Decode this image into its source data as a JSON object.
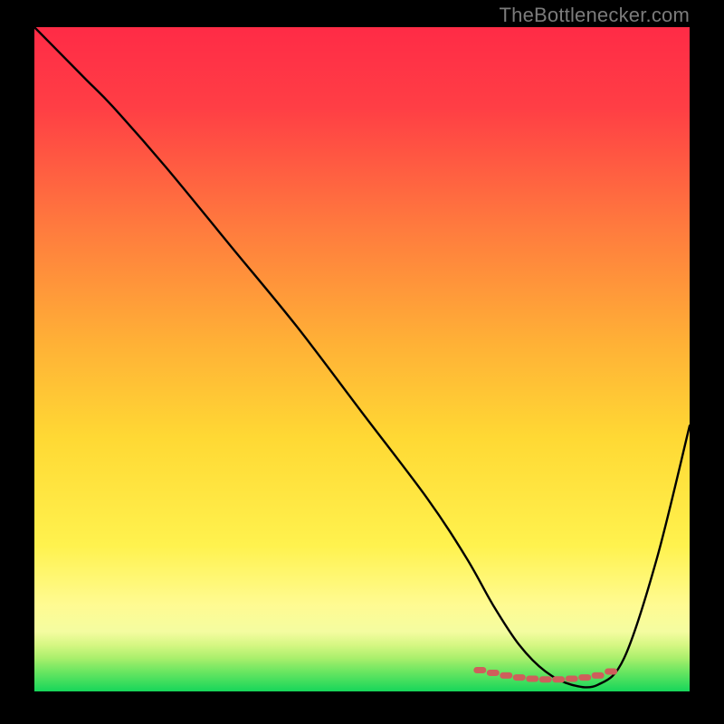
{
  "watermark": "TheBottlenecker.com",
  "chart_data": {
    "type": "line",
    "title": "",
    "xlabel": "",
    "ylabel": "",
    "xlim": [
      0,
      100
    ],
    "ylim": [
      0,
      100
    ],
    "background_gradient": {
      "top": "#ff2b46",
      "mid_upper": "#ff8a3a",
      "mid": "#ffd934",
      "mid_lower": "#fff77a",
      "green_top": "#b6f56a",
      "green_bottom": "#16d65a"
    },
    "series": [
      {
        "name": "curve",
        "color": "#000000",
        "x": [
          0,
          5,
          8,
          12,
          20,
          30,
          40,
          50,
          60,
          66,
          70,
          74,
          78,
          82,
          86,
          90,
          95,
          100
        ],
        "y": [
          100,
          95,
          92,
          88,
          79,
          67,
          55,
          42,
          29,
          20,
          13,
          7,
          3,
          1,
          1,
          5,
          20,
          40
        ]
      },
      {
        "name": "valley-highlight",
        "color": "#ce5f5b",
        "type": "scatter",
        "x": [
          68,
          70,
          72,
          74,
          76,
          78,
          80,
          82,
          84,
          86,
          88
        ],
        "y": [
          3.2,
          2.8,
          2.4,
          2.1,
          1.9,
          1.8,
          1.8,
          1.9,
          2.1,
          2.4,
          3.0
        ]
      }
    ]
  }
}
